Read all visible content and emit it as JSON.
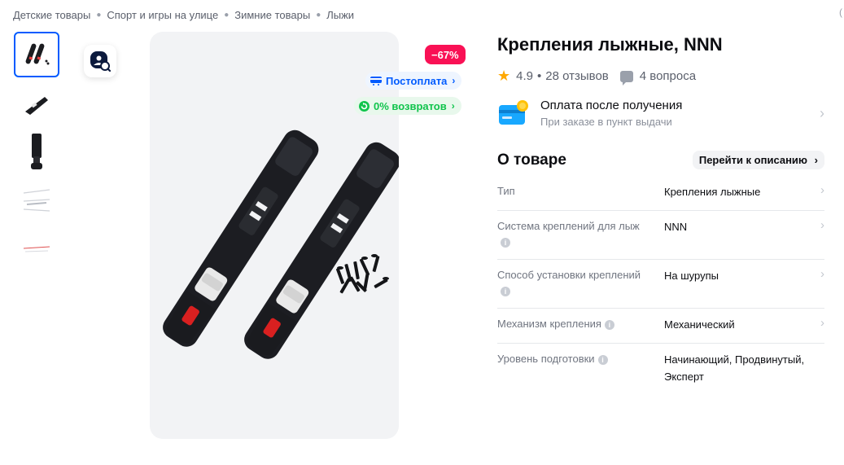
{
  "breadcrumbs": [
    "Детские товары",
    "Спорт и игры на улице",
    "Зимние товары",
    "Лыжи"
  ],
  "product": {
    "title": "Крепления лыжные, NNN",
    "discount": "−67%",
    "rating": "4.9",
    "reviews": "28 отзывов",
    "questions": "4 вопроса"
  },
  "badges": {
    "postpay": "Постоплата",
    "returns": "0% возвратов"
  },
  "payment": {
    "title": "Оплата после получения",
    "subtitle": "При заказе в пункт выдачи"
  },
  "about": {
    "heading": "О товаре",
    "go_label": "Перейти к описанию"
  },
  "specs": [
    {
      "key": "Тип",
      "value": "Крепления лыжные",
      "info": false
    },
    {
      "key": "Система креплений для лыж",
      "value": "NNN",
      "info": true
    },
    {
      "key": "Способ установки креплений",
      "value": "На шурупы",
      "info": true
    },
    {
      "key": "Механизм крепления",
      "value": "Механический",
      "info": true
    },
    {
      "key": "Уровень подготовки",
      "value": "Начинающий, Продвинутый, Эксперт",
      "info": true
    }
  ],
  "colors": {
    "accent": "#005bff",
    "discount": "#f91155",
    "success": "#10c44c",
    "star": "#ffa800"
  },
  "icons": {
    "star": "star-icon",
    "questions": "chat-icon",
    "zoom": "image-search-icon",
    "payment": "card-icon"
  }
}
